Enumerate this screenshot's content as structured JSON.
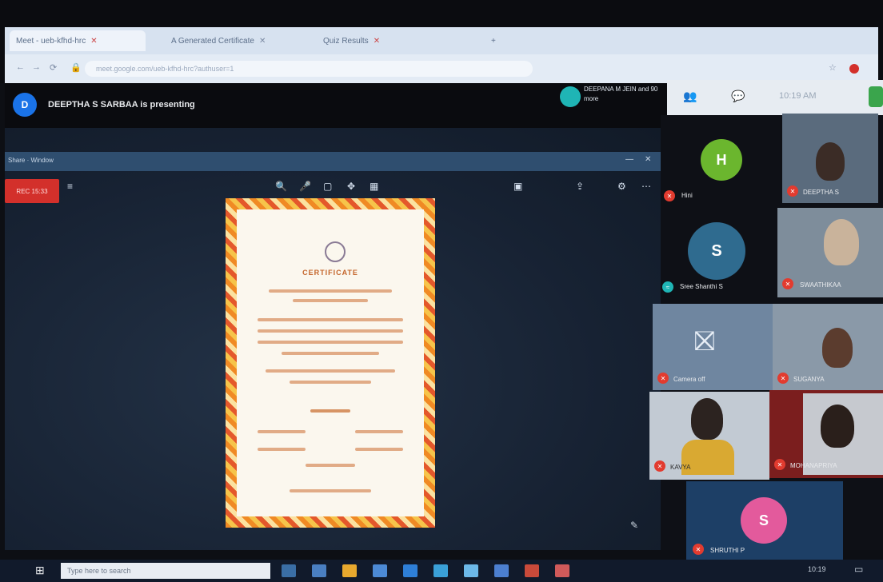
{
  "browser": {
    "tabs": [
      {
        "label": "Meet - ueb-kfhd-hrc"
      },
      {
        "label": "A Generated Certificate"
      },
      {
        "label": "Quiz Results"
      },
      {
        "label": "+"
      }
    ],
    "url": "meet.google.com/ueb-kfhd-hrc?authuser=1",
    "clock": "10:19 AM"
  },
  "meet": {
    "presenter_initial": "D",
    "presenter_text": "DEEPTHA S SARBAA is presenting",
    "top_pill_text": "DEEPANA M JEIN and 90 more",
    "recording_label": "REC 15:33",
    "toolbar_label": "Share · Window",
    "doc_title": "CERTIFICATE",
    "participants": [
      {
        "initial": "H",
        "name": "Hini",
        "color": "#6bb62e"
      },
      {
        "initial": "S",
        "name": "Sree Shanthi S",
        "color": "#2f6b8f"
      },
      {
        "name": "DEEPTHA S"
      },
      {
        "name": "SWAATHIKAA"
      },
      {
        "name": "Camera off"
      },
      {
        "name": "SUGANYA"
      },
      {
        "name": "KAVYA"
      },
      {
        "name": "MOHANAPRIYA"
      },
      {
        "initial": "S",
        "name": "SHRUTHI P",
        "color": "#e35a9c"
      }
    ]
  },
  "taskbar": {
    "search_placeholder": "Type here to search",
    "time": "10:19"
  },
  "colors": {
    "accent_red": "#d3302b",
    "meet_bg": "#0a0b0f",
    "slide_bg": "#172233"
  }
}
